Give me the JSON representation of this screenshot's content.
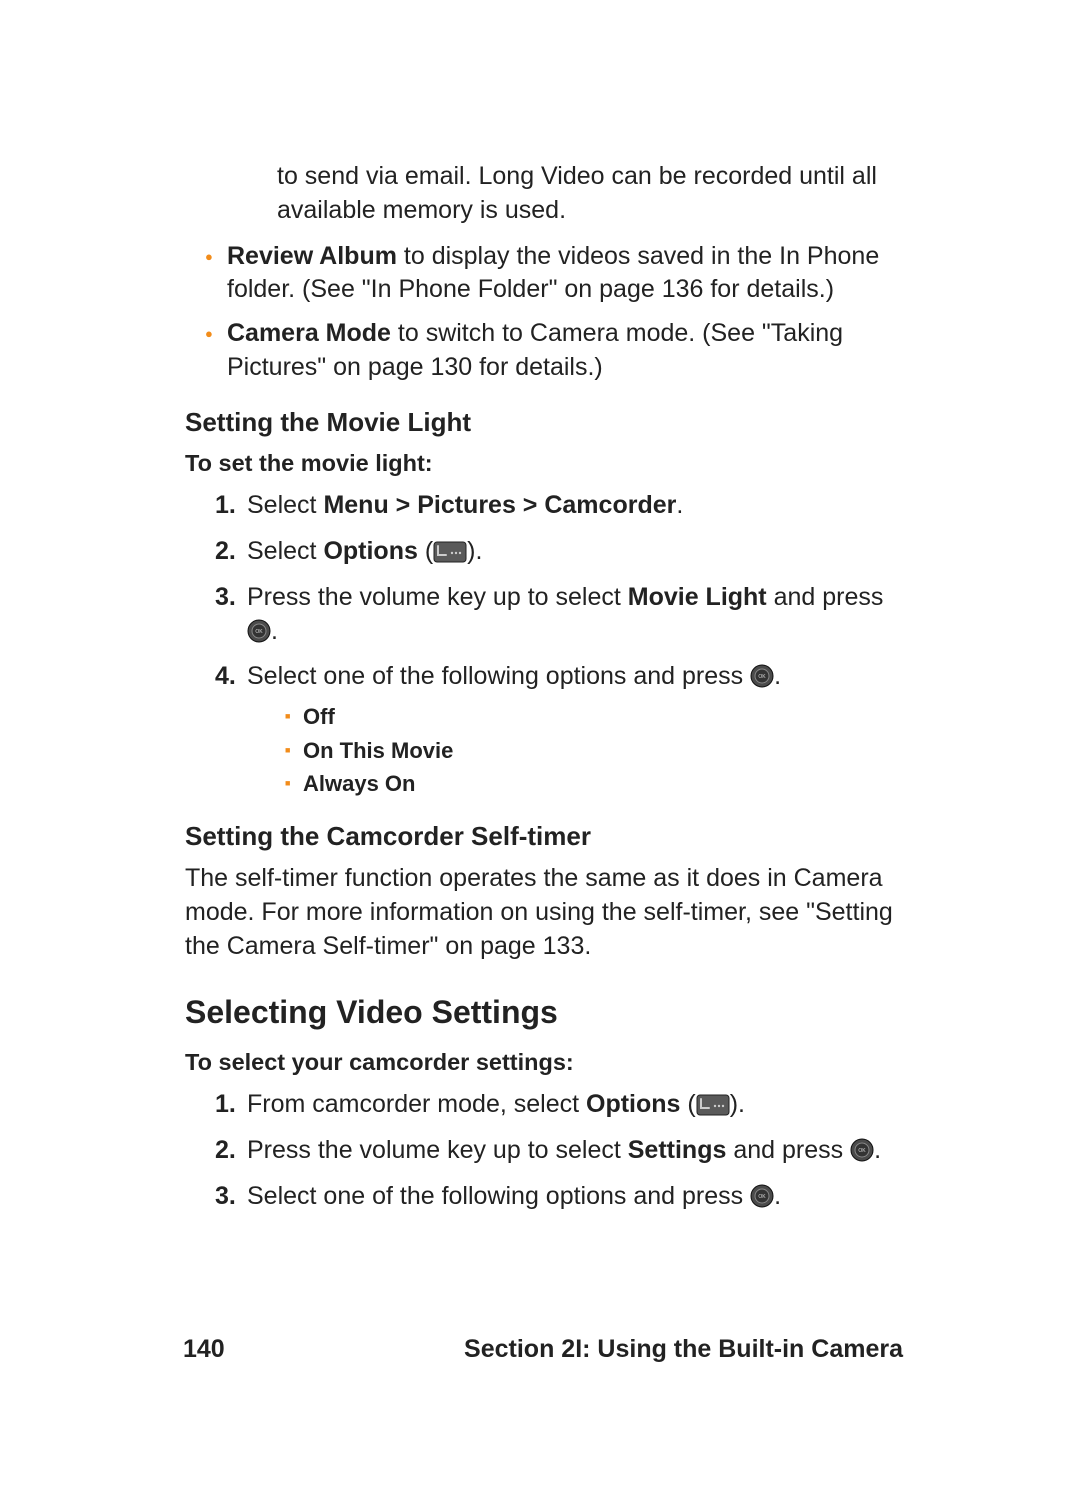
{
  "continued_paragraph": "to send via email. Long Video can be recorded until all available memory is used.",
  "bullets": [
    {
      "bold": "Review Album",
      "rest": " to display the videos saved in the In Phone folder. (See \"In Phone Folder\" on page 136 for details.)"
    },
    {
      "bold": "Camera Mode",
      "rest": " to switch to Camera mode. (See \"Taking Pictures\" on page 130 for details.)"
    }
  ],
  "movie_light": {
    "heading": "Setting the Movie Light",
    "intro": "To set the movie light:",
    "steps": {
      "s1_a": "Select ",
      "s1_b": "Menu > Pictures > Camcorder",
      "s1_c": ".",
      "s2_a": "Select ",
      "s2_b": "Options",
      "s2_c": " (",
      "s2_d": ").",
      "s3_a": "Press the volume key up to select ",
      "s3_b": "Movie Light",
      "s3_c": " and press ",
      "s3_d": ".",
      "s4_a": "Select one of the following options and press ",
      "s4_b": "."
    },
    "options": [
      "Off",
      "On This Movie",
      "Always On"
    ]
  },
  "self_timer": {
    "heading": "Setting the Camcorder Self-timer",
    "text": "The self-timer function operates the same as it does in Camera mode. For more information on using the self-timer, see \"Setting the Camera Self-timer\" on page 133."
  },
  "video_settings": {
    "heading": "Selecting Video Settings",
    "intro": "To select your camcorder settings:",
    "steps": {
      "s1_a": "From camcorder mode, select ",
      "s1_b": "Options",
      "s1_c": " (",
      "s1_d": ").",
      "s2_a": "Press the volume key up to select ",
      "s2_b": "Settings",
      "s2_c": " and press ",
      "s2_d": ".",
      "s3_a": "Select one of the following options and press ",
      "s3_b": "."
    }
  },
  "footer": {
    "page_number": "140",
    "section": "Section 2I: Using the Built-in Camera"
  }
}
